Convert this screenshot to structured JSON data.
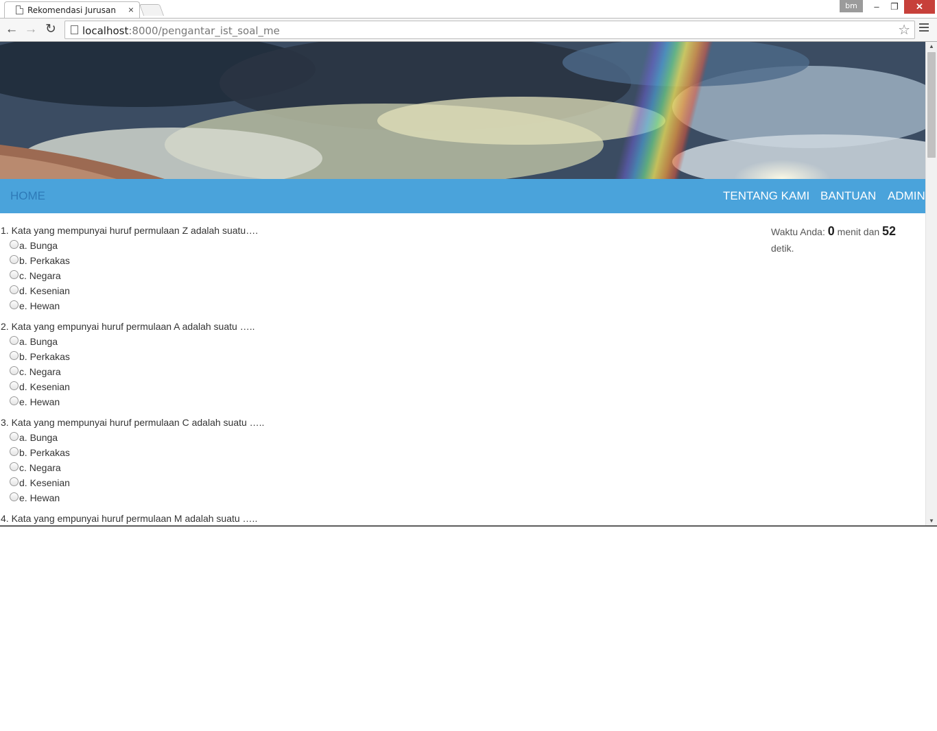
{
  "browser": {
    "tab_title": "Rekomendasi Jurusan",
    "tab_close": "×",
    "profile": "bm",
    "url_host": "localhost",
    "url_rest": ":8000/pengantar_ist_soal_me"
  },
  "nav": {
    "home": "HOME",
    "about": "TENTANG KAMI",
    "help": "BANTUAN",
    "admin": "ADMIN"
  },
  "timer": {
    "label": "Waktu Anda:",
    "minutes": "0",
    "minutes_label": "menit dan",
    "seconds": "52",
    "seconds_label": "detik."
  },
  "questions": [
    {
      "text": "1. Kata yang mempunyai huruf permulaan Z adalah suatu….",
      "options": [
        "a. Bunga",
        "b. Perkakas",
        "c. Negara",
        "d. Kesenian",
        "e. Hewan"
      ]
    },
    {
      "text": "2. Kata yang empunyai huruf permulaan A adalah suatu …..",
      "options": [
        "a. Bunga",
        "b. Perkakas",
        "c. Negara",
        "d. Kesenian",
        "e. Hewan"
      ]
    },
    {
      "text": "3. Kata yang mempunyai huruf permulaan C adalah suatu …..",
      "options": [
        "a. Bunga",
        "b. Perkakas",
        "c. Negara",
        "d. Kesenian",
        "e. Hewan"
      ]
    },
    {
      "text": "4. Kata yang empunyai huruf permulaan M adalah suatu …..",
      "options": []
    }
  ]
}
